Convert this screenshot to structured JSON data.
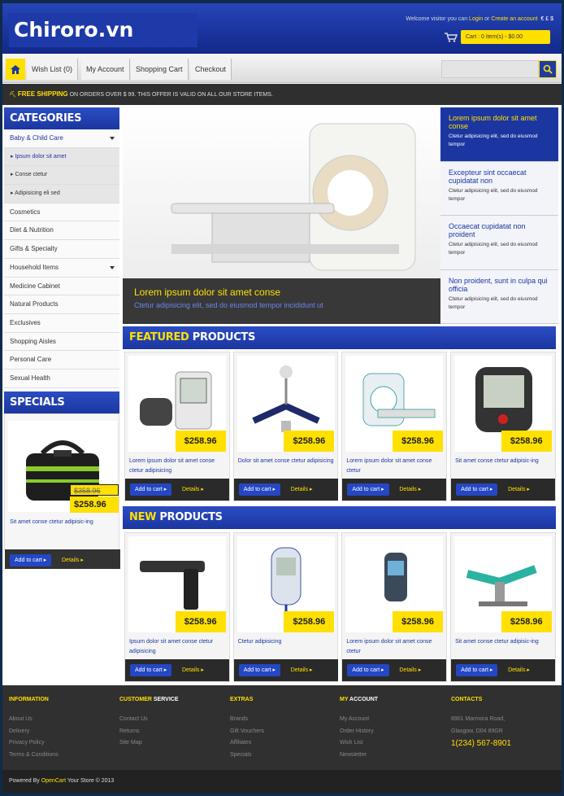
{
  "brand": {
    "logo": "Chiroro.vn"
  },
  "header": {
    "welcome": "Welcome visitor you can",
    "login": "Login",
    "or": "or",
    "create": "Create an account",
    "currencies": "€ £ $",
    "cart": "Cart : 0 item(s) - $0.00"
  },
  "nav": {
    "items": [
      "Wish List (0)",
      "My Account",
      "Shopping Cart",
      "Checkout"
    ],
    "search_placeholder": ""
  },
  "shipping": {
    "bold": "FREE SHIPPING",
    "text": "ON ORDERS OVER $ 99. THIS OFFER IS VALID ON ALL OUR STORE ITEMS."
  },
  "categories": {
    "title": "CATEGORIES",
    "items": [
      "Baby & Child Care",
      "Ipsum dolor sit amet",
      "Conse ctetur",
      "Adipisicing eli sed",
      "Cosmetics",
      "Diet & Nutrition",
      "Gifts & Specialty",
      "Household Items",
      "Medicine Cabinet",
      "Natural Products",
      "Exclusives",
      "Shopping Aisles",
      "Personal Care",
      "Sexual Health"
    ]
  },
  "specials": {
    "title": "SPECIALS",
    "old_price": "$358.96",
    "price": "$258.96",
    "desc": "Sit amet conse ctetur adipisic-ing",
    "add": "Add to cart ▸",
    "details": "Details ▸"
  },
  "slider": {
    "title": "Lorem ipsum dolor sit amet conse",
    "subtitle": "Ctetur adipisicing elit, sed do eiusmod tempor incididunt ut",
    "items": [
      {
        "t": "Lorem ipsum dolor sit amet conse",
        "d": "Ctetur adipisicing elit, sed do eiusmod tempor"
      },
      {
        "t": "Excepteur sint occaecat cupidatat non",
        "d": "Ctetur adipisicing elit, sed do eiusmod tempor"
      },
      {
        "t": "Occaecat cupidatat non proident",
        "d": "Ctetur adipisicing elit, sed do eiusmod tempor"
      },
      {
        "t": "Non proident, sunt in culpa qui officia",
        "d": "Ctetur adipisicing elit, sed do eiusmod tempor"
      }
    ]
  },
  "featured": {
    "title_y": "FEATURED",
    "title_w": " PRODUCTS",
    "products": [
      {
        "price": "$258.96",
        "desc": "Lorem ipsum dolor sit amet conse ctetur adipisicing"
      },
      {
        "price": "$258.96",
        "desc": "Dolor sit amet conse ctetur adipisicing"
      },
      {
        "price": "$258.96",
        "desc": "Lorem ipsum dolor sit amet conse ctetur"
      },
      {
        "price": "$258.96",
        "desc": "Sit amet conse ctetur adipisic-ing"
      }
    ]
  },
  "newp": {
    "title_y": "NEW",
    "title_w": " PRODUCTS",
    "products": [
      {
        "price": "$258.96",
        "desc": "Ipsum dolor sit amet conse ctetur adipisicing"
      },
      {
        "price": "$258.96",
        "desc": "Ctetur adipisicing"
      },
      {
        "price": "$258.96",
        "desc": "Lorem ipsum dolor sit amet conse ctetur"
      },
      {
        "price": "$258.96",
        "desc": "Sit amet conse ctetur adipisic-ing"
      }
    ]
  },
  "buttons": {
    "add": "Add to cart ▸",
    "details": "Details ▸"
  },
  "footer": {
    "info": {
      "h": "INFORMATION",
      "links": [
        "About Us",
        "Delivery",
        "Privacy Policy",
        "Terms & Conditions"
      ]
    },
    "cs": {
      "hy": "CUSTOMER",
      "hw": " SERVICE",
      "links": [
        "Contact Us",
        "Returns",
        "Site Map"
      ]
    },
    "extras": {
      "h": "EXTRAS",
      "links": [
        "Brands",
        "Gift Vouchers",
        "Affiliates",
        "Specials"
      ]
    },
    "acct": {
      "hy": "MY",
      "hw": " ACCOUNT",
      "links": [
        "My Account",
        "Order History",
        "Wish List",
        "Newsletter"
      ]
    },
    "contacts": {
      "h": "CONTACTS",
      "addr1": "8901 Marmora Road,",
      "addr2": "Glasgow, D04 89GR",
      "phone": "1(234) 567-8901"
    },
    "copy_pre": "Powered By",
    "copy_link": "OpenCart",
    "copy_post": "Your Store © 2013"
  }
}
